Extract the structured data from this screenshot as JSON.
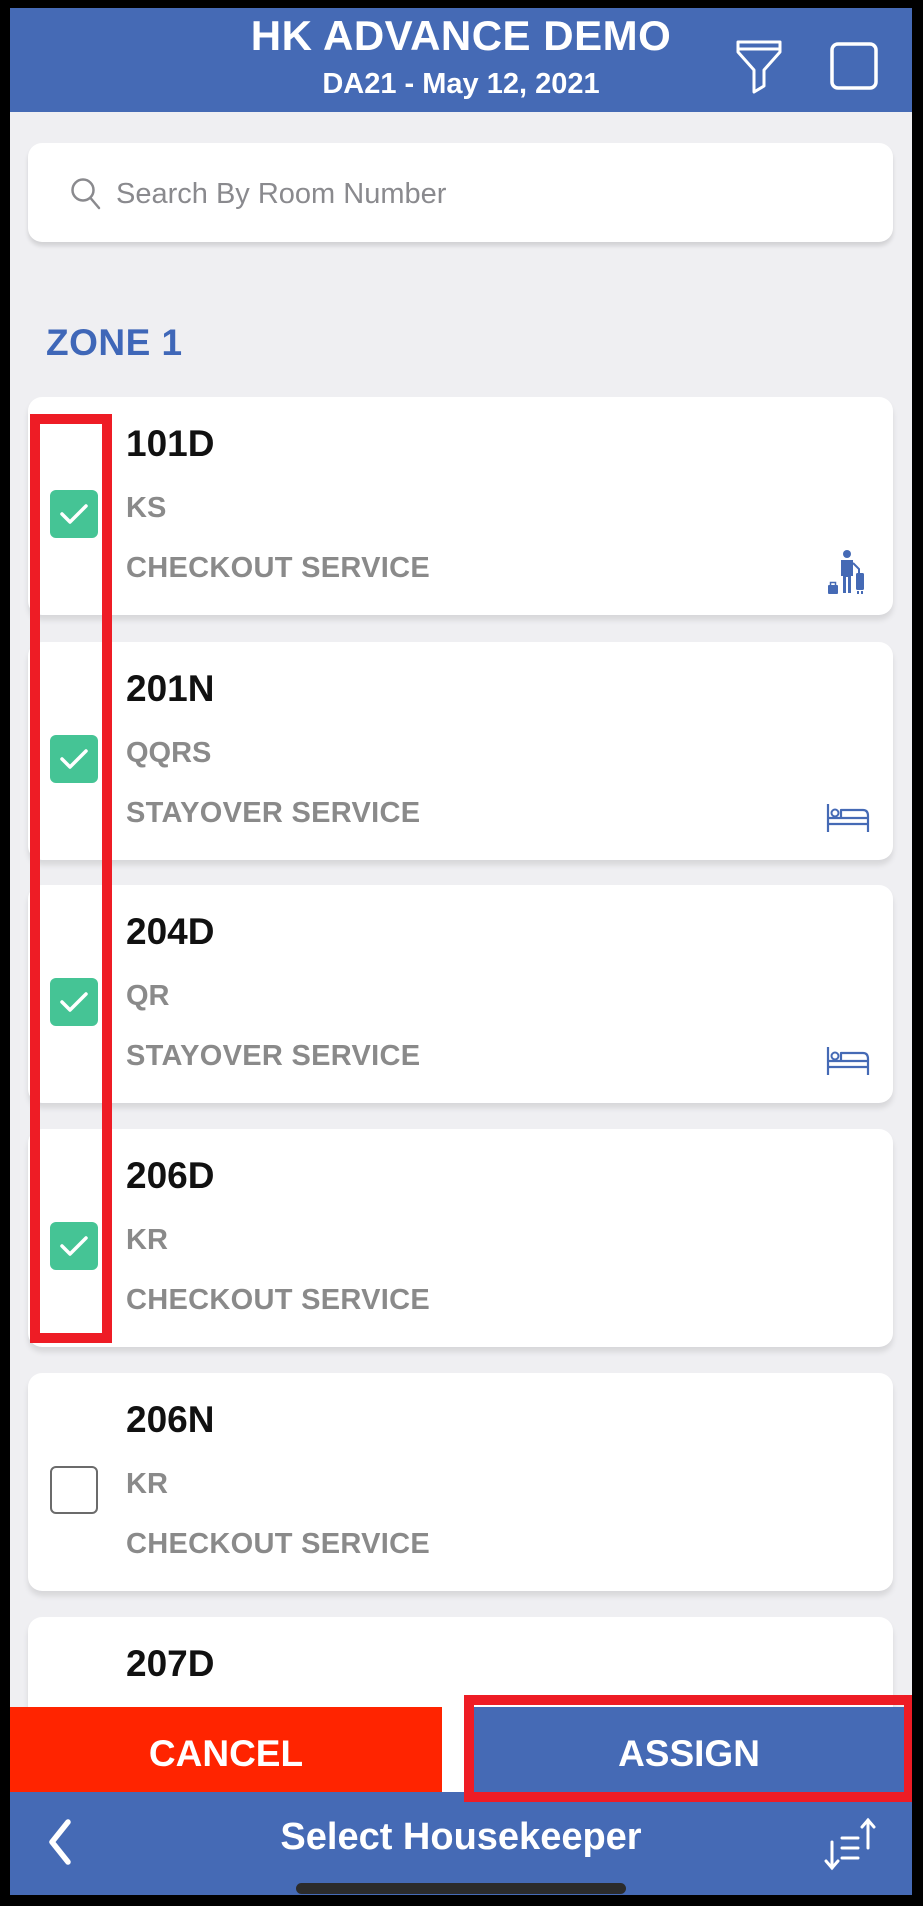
{
  "header": {
    "title": "HK ADVANCE DEMO",
    "subtitle": "DA21 - May 12, 2021",
    "filter_icon": "filter-funnel-icon",
    "select_all_icon": "checkbox-empty-icon"
  },
  "search": {
    "placeholder": "Search By Room Number",
    "value": "",
    "icon": "search-icon"
  },
  "zone": {
    "title": "ZONE 1"
  },
  "rooms": [
    {
      "room": "101D",
      "code": "KS",
      "service": "CHECKOUT SERVICE",
      "checked": true,
      "status_icon": "guest-with-luggage-icon"
    },
    {
      "room": "201N",
      "code": "QQRS",
      "service": "STAYOVER SERVICE",
      "checked": true,
      "status_icon": "bed-icon"
    },
    {
      "room": "204D",
      "code": "QR",
      "service": "STAYOVER SERVICE",
      "checked": true,
      "status_icon": "bed-icon"
    },
    {
      "room": "206D",
      "code": "KR",
      "service": "CHECKOUT SERVICE",
      "checked": true,
      "status_icon": ""
    },
    {
      "room": "206N",
      "code": "KR",
      "service": "CHECKOUT SERVICE",
      "checked": false,
      "status_icon": ""
    },
    {
      "room": "207D",
      "code": "",
      "service": "",
      "checked": false,
      "status_icon": ""
    }
  ],
  "actions": {
    "cancel_label": "CANCEL",
    "assign_label": "ASSIGN"
  },
  "bottom_bar": {
    "title": "Select Housekeeper",
    "back_icon": "chevron-left-icon",
    "sort_icon": "sort-icon"
  },
  "colors": {
    "brand_blue": "#456AB5",
    "cancel_red": "#FF2400",
    "check_green": "#45C495",
    "highlight_red": "#EE1C25",
    "zone_blue": "#3F67B8"
  }
}
